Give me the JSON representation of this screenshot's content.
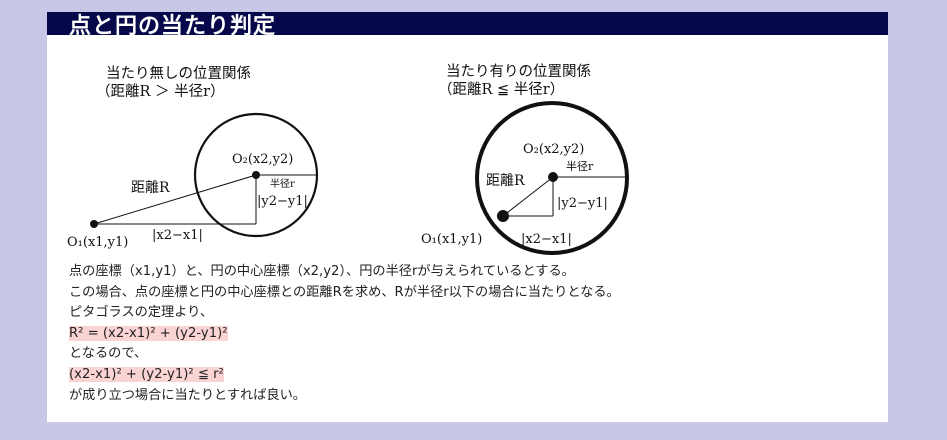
{
  "header": {
    "title": "点と円の当たり判定"
  },
  "left_diagram": {
    "caption_line1": "当たり無しの位置関係",
    "caption_line2": "（距離R ＞ 半径r）",
    "label_o2": "O₂(x2,y2)",
    "label_radius": "半径r",
    "label_distance": "距離R",
    "label_dy": "|y2−y1|",
    "label_dx": "|x2−x1|",
    "label_o1": "O₁(x1,y1)"
  },
  "right_diagram": {
    "caption_line1": "当たり有りの位置関係",
    "caption_line2": "（距離R ≦ 半径r）",
    "label_o2": "O₂(x2,y2)",
    "label_radius": "半径r",
    "label_distance": "距離R",
    "label_dy": "|y2−y1|",
    "label_dx": "|x2−x1|",
    "label_o1": "O₁(x1,y1)"
  },
  "description": {
    "line1": "点の座標（x1,y1）と、円の中心座標（x2,y2）、円の半径rが与えられているとする。",
    "line2": "この場合、点の座標と円の中心座標との距離Rを求め、Rが半径r以下の場合に当たりとなる。",
    "line3": "ピタゴラスの定理より、",
    "formula1": "R² = (x2-x1)² + (y2-y1)²",
    "line4": "となるので、",
    "formula2": "(x2-x1)² + (y2-y1)² ≦ r²",
    "line5": "が成り立つ場合に当たりとすれば良い。"
  },
  "colors": {
    "background": "#c8c8e6",
    "header": "#06084a",
    "highlight": "#fad3d3"
  }
}
